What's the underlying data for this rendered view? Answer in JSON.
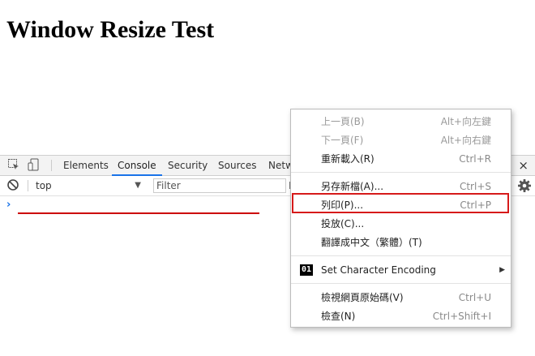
{
  "page": {
    "heading": "Window Resize Test"
  },
  "devtools": {
    "tabs": [
      {
        "label": "Elements",
        "active": false
      },
      {
        "label": "Console",
        "active": true
      },
      {
        "label": "Security",
        "active": false
      },
      {
        "label": "Sources",
        "active": false
      },
      {
        "label": "Netw",
        "active": false
      }
    ],
    "close_glyph": "×",
    "toolbar": {
      "context": "top",
      "filter_placeholder": "Filter",
      "filter_trailing_char": "D"
    },
    "prompt_glyph": "›",
    "annotation_color": "#cc0000"
  },
  "context_menu": {
    "items": [
      {
        "label": "上一頁(B)",
        "shortcut": "Alt+向左鍵",
        "disabled": true
      },
      {
        "label": "下一頁(F)",
        "shortcut": "Alt+向右鍵",
        "disabled": true
      },
      {
        "label": "重新載入(R)",
        "shortcut": "Ctrl+R",
        "disabled": false
      },
      {
        "label": "另存新檔(A)...",
        "shortcut": "Ctrl+S",
        "disabled": false
      },
      {
        "label": "列印(P)...",
        "shortcut": "Ctrl+P",
        "disabled": false,
        "highlighted": true
      },
      {
        "label": "投放(C)...",
        "shortcut": "",
        "disabled": false
      },
      {
        "label": "翻譯成中文（繁體）(T)",
        "shortcut": "",
        "disabled": false
      },
      {
        "label": "Set Character Encoding",
        "shortcut": "",
        "icon_text": "01",
        "submenu": true
      },
      {
        "label": "檢視網頁原始碼(V)",
        "shortcut": "Ctrl+U",
        "disabled": false
      },
      {
        "label": "檢查(N)",
        "shortcut": "Ctrl+Shift+I",
        "disabled": false
      }
    ],
    "submenu_glyph": "▶",
    "highlight_color": "#d61a1a"
  }
}
